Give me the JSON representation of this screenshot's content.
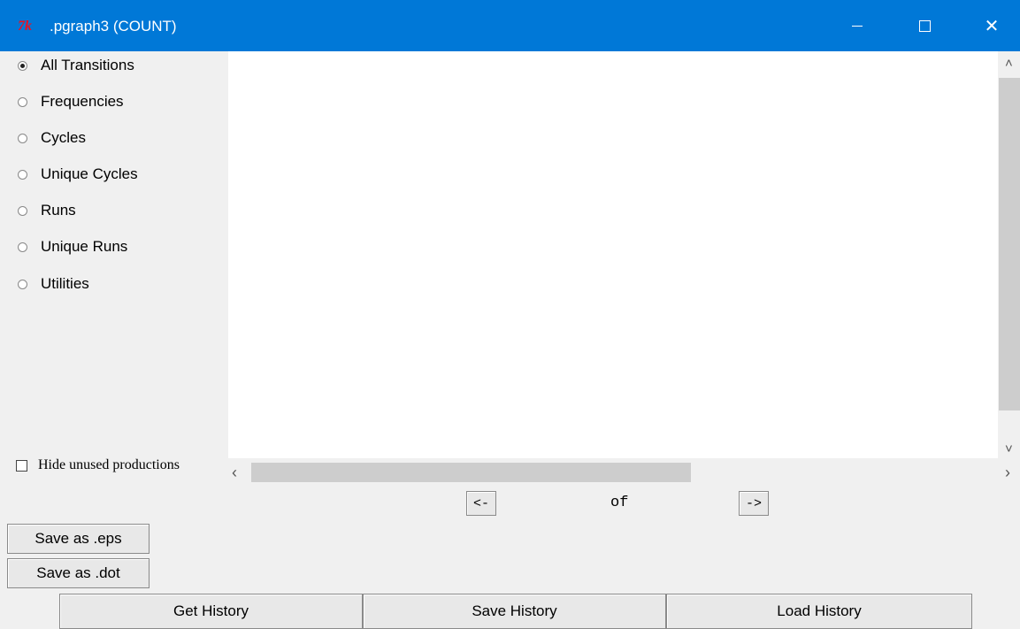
{
  "window": {
    "title": ".pgraph3 (COUNT)",
    "icon": "tk-feather-icon",
    "accent_color": "#0078d7"
  },
  "views": [
    {
      "label": "All Transitions",
      "checked": true
    },
    {
      "label": "Frequencies",
      "checked": false
    },
    {
      "label": "Cycles",
      "checked": false
    },
    {
      "label": "Unique Cycles",
      "checked": false
    },
    {
      "label": "Runs",
      "checked": false
    },
    {
      "label": "Unique Runs",
      "checked": false
    },
    {
      "label": "Utilities",
      "checked": false
    }
  ],
  "hide_unused": {
    "label": "Hide unused productions",
    "checked": false
  },
  "pager": {
    "prev_label": "<-",
    "of_label": "of",
    "next_label": "->"
  },
  "save_buttons": {
    "eps_label": "Save as .eps",
    "dot_label": "Save as .dot"
  },
  "history_buttons": {
    "get_label": "Get History",
    "save_label": "Save History",
    "load_label": "Load History"
  }
}
